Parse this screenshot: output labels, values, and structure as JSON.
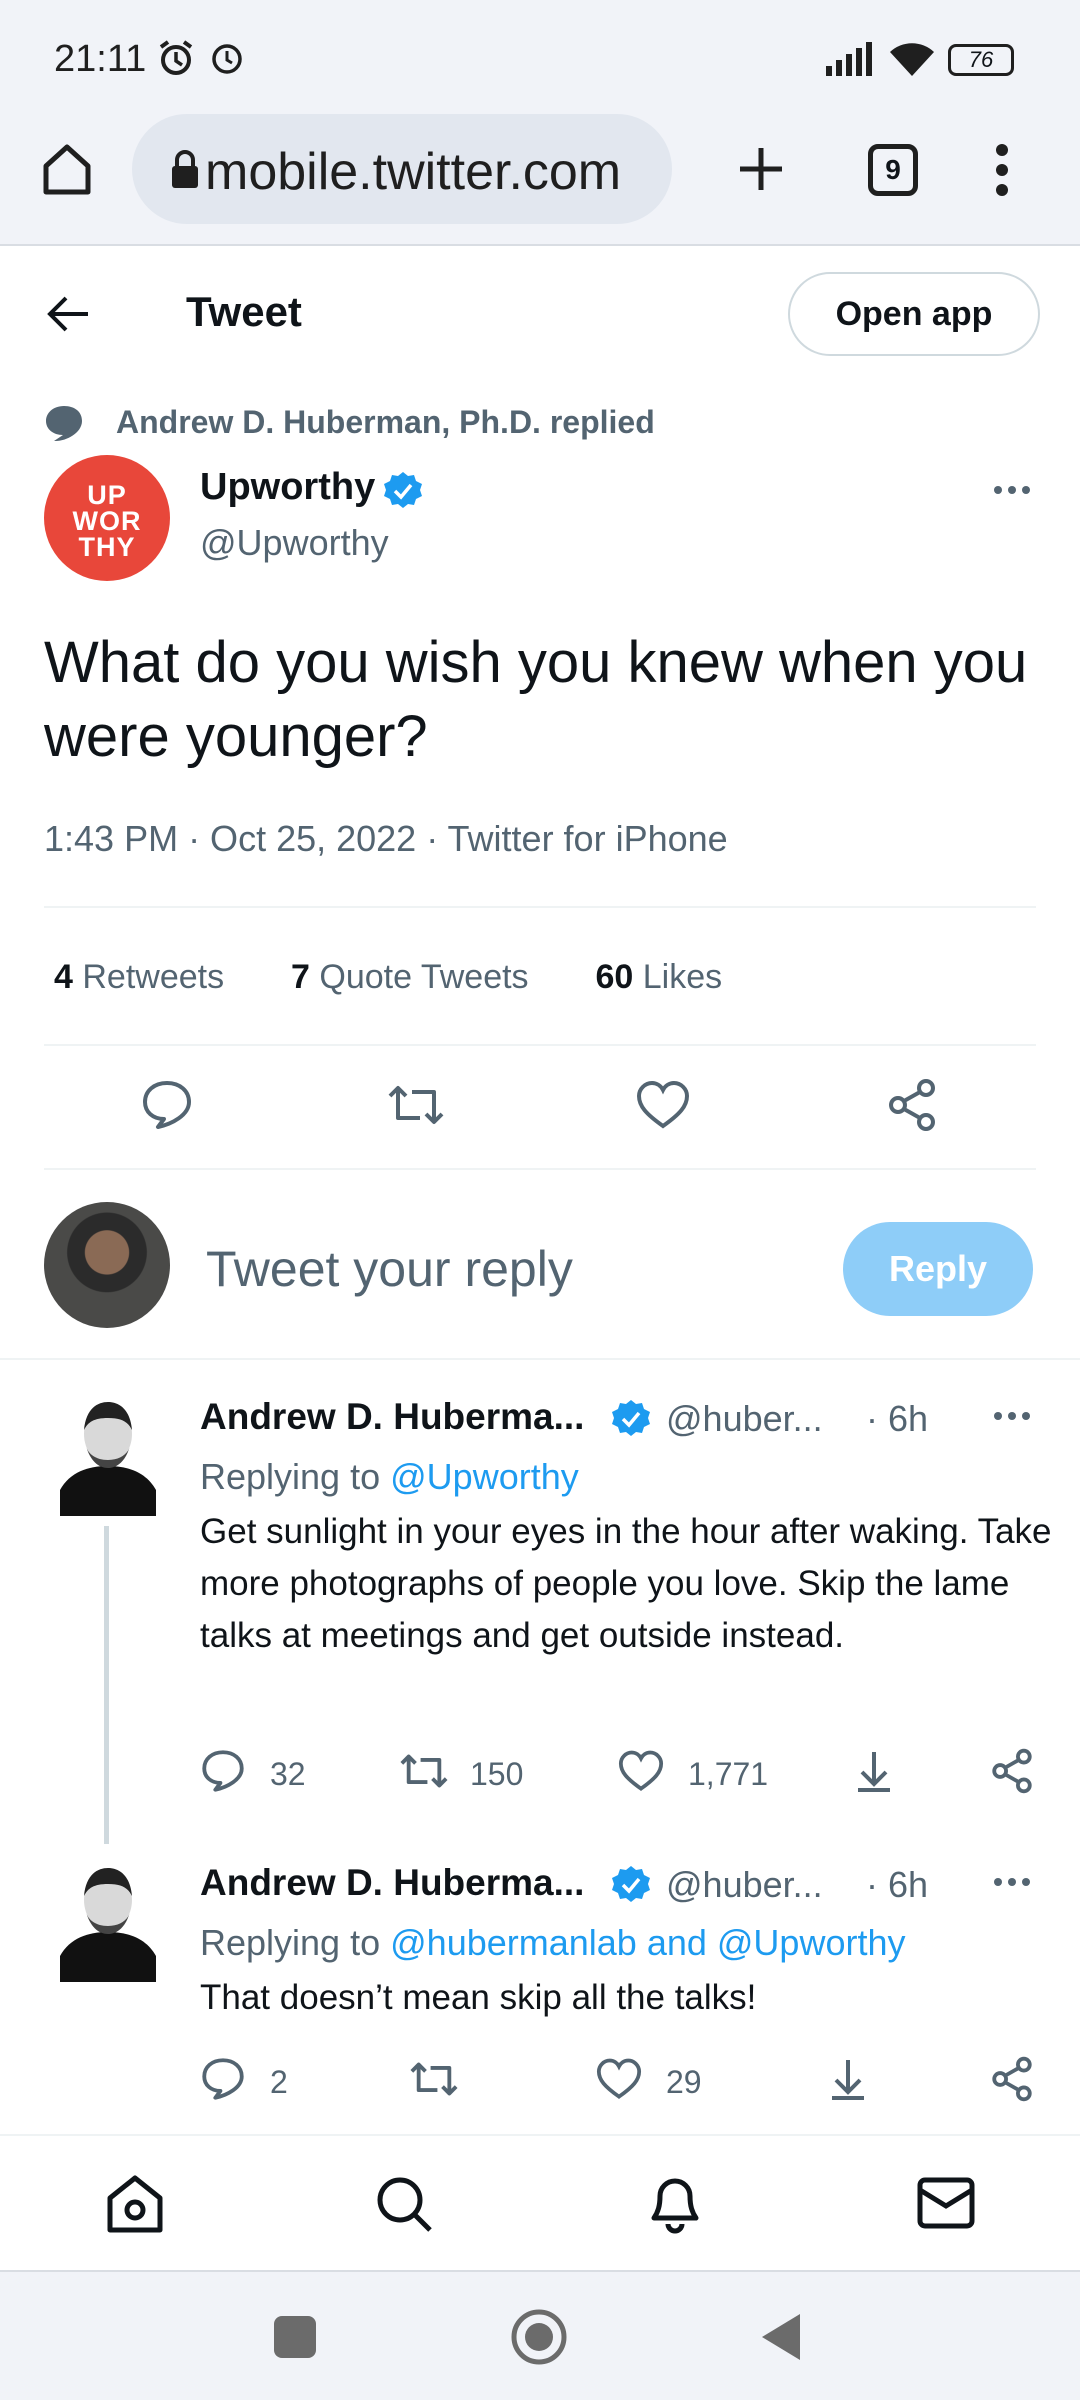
{
  "status_bar": {
    "time": "21:11",
    "battery": "76"
  },
  "browser": {
    "url": "mobile.twitter.com",
    "tab_count": "9"
  },
  "header": {
    "title": "Tweet",
    "open_app": "Open app"
  },
  "social_context": "Andrew D. Huberman, Ph.D. replied",
  "tweet": {
    "avatar_text": [
      "UP",
      "WOR",
      "THY"
    ],
    "name": "Upworthy",
    "handle": "@Upworthy",
    "text": "What do you wish you knew when you were younger?",
    "meta": "1:43 PM · Oct 25, 2022 · Twitter for iPhone",
    "stats": {
      "retweets_count": "4",
      "retweets_label": "Retweets",
      "quotes_count": "7",
      "quotes_label": "Quote Tweets",
      "likes_count": "60",
      "likes_label": "Likes"
    }
  },
  "composer": {
    "placeholder": "Tweet your reply",
    "button": "Reply"
  },
  "replies": [
    {
      "name": "Andrew D. Huberma...",
      "handle": "@huber...",
      "time": "· 6h",
      "replying_prefix": "Replying to",
      "replying_to": "@Upworthy",
      "text": "Get sunlight in your eyes in the hour after waking. Take more photographs of people you love. Skip the lame talks at meetings and get outside instead.",
      "replies": "32",
      "retweets": "150",
      "likes": "1,771"
    },
    {
      "name": "Andrew D. Huberma...",
      "handle": "@huber...",
      "time": "· 6h",
      "replying_prefix": "Replying to",
      "replying_to": "@hubermanlab and @Upworthy",
      "text": "That doesn’t mean skip all the talks!",
      "replies": "2",
      "retweets": "",
      "likes": "29"
    }
  ],
  "colors": {
    "accent": "#1d9bf0",
    "verified": "#1d9bf0",
    "muted": "#536471",
    "reply_disabled": "#8ecdf8",
    "upworthy": "#e8473a"
  }
}
